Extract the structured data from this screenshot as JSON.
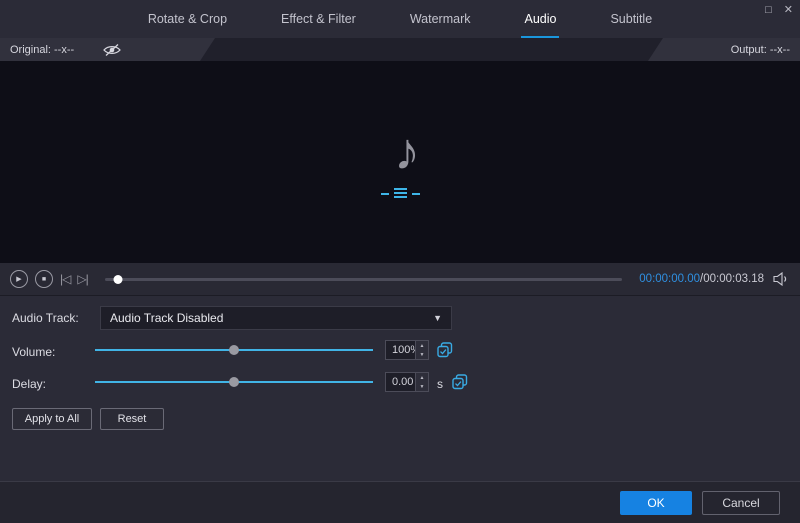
{
  "window": {
    "maximize_icon": "□",
    "close_icon": "✕"
  },
  "tabs": [
    {
      "label": "Rotate & Crop"
    },
    {
      "label": "Effect & Filter"
    },
    {
      "label": "Watermark"
    },
    {
      "label": "Audio"
    },
    {
      "label": "Subtitle"
    }
  ],
  "preview_bar": {
    "original_label": "Original: --x--",
    "output_label": "Output: --x--"
  },
  "preview": {
    "note_icon": "♪"
  },
  "player": {
    "play_icon": "▶",
    "stop_icon": "■",
    "prev_icon": "|◁",
    "next_icon": "▷|",
    "seek_pos": 0.025,
    "time_current": "00:00:00.00",
    "time_total": "/00:00:03.18"
  },
  "audio": {
    "track_label": "Audio Track:",
    "track_value": "Audio Track Disabled",
    "dropdown_arrow": "▼",
    "volume_label": "Volume:",
    "volume_value": "100%",
    "volume_pos": 0.5,
    "delay_label": "Delay:",
    "delay_value": "0.00",
    "delay_unit": "s",
    "delay_pos": 0.5,
    "spinner_up": "▲",
    "spinner_down": "▼",
    "apply_all_label": "Apply to All",
    "reset_label": "Reset"
  },
  "footer": {
    "ok_label": "OK",
    "cancel_label": "Cancel"
  },
  "colors": {
    "accent": "#2f8fe0",
    "slider": "#41b4e6",
    "ok_button": "#1682e2"
  }
}
